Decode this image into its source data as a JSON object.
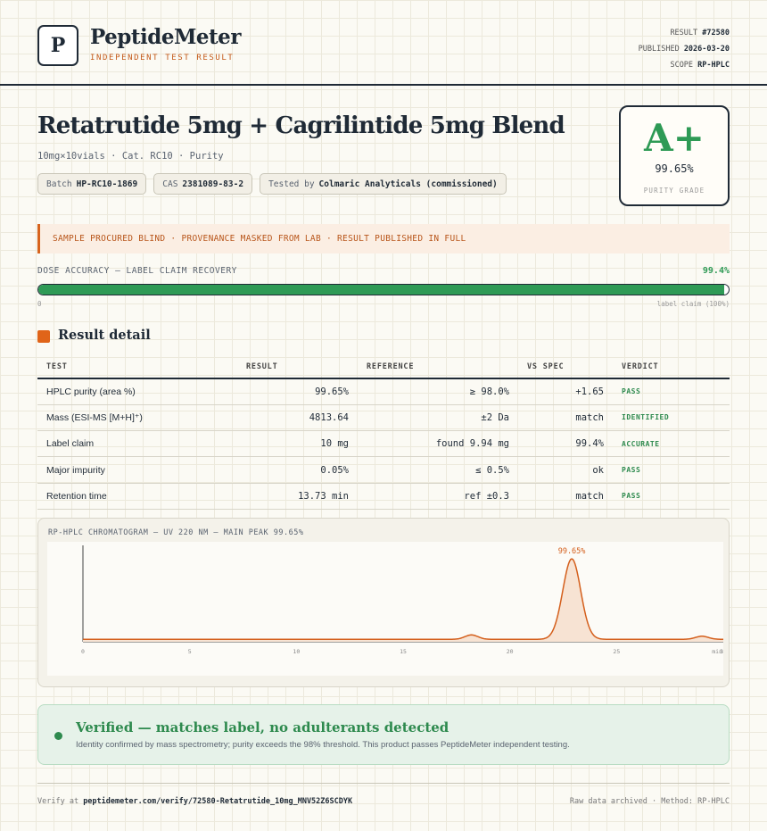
{
  "header": {
    "logo_letter": "P",
    "brand": "PeptideMeter",
    "tagline": "INDEPENDENT TEST RESULT",
    "result_label": "RESULT",
    "result_value": "#72580",
    "published_label": "PUBLISHED",
    "published_value": "2026-03-20",
    "scope_label": "SCOPE",
    "scope_value": "RP-HPLC"
  },
  "product": {
    "title": "Retatrutide 5mg + Cagrilintide 5mg Blend",
    "subtitle": "10mg×10vials · Cat. RC10 · Purity",
    "batch_label": "Batch",
    "batch_value": "HP-RC10-1869",
    "cas_label": "CAS",
    "cas_value": "2381089-83-2",
    "tested_label": "Tested by",
    "tested_value": "Colmaric Analyticals (commissioned)"
  },
  "grade": {
    "letter": "A+",
    "purity": "99.65%",
    "label": "PURITY GRADE",
    "color": "#2e9a55"
  },
  "notice": "SAMPLE PROCURED BLIND · PROVENANCE MASKED FROM LAB · RESULT PUBLISHED IN FULL",
  "dose": {
    "label": "DOSE ACCURACY — LABEL CLAIM RECOVERY",
    "value_text": "99.4%",
    "fraction": 0.994,
    "min_label": "0",
    "max_label": "label claim (100%)"
  },
  "results": {
    "title": "Result detail",
    "columns": [
      "TEST",
      "RESULT",
      "REFERENCE",
      "VS SPEC",
      "VERDICT"
    ],
    "rows": [
      {
        "test": "HPLC purity (area %)",
        "result": "99.65%",
        "reference": "≥ 98.0%",
        "vs_spec": "+1.65",
        "verdict": "PASS"
      },
      {
        "test": "Mass (ESI-MS [M+H]⁺)",
        "result": "4813.64",
        "reference": "±2 Da",
        "vs_spec": "match",
        "verdict": "IDENTIFIED"
      },
      {
        "test": "Label claim",
        "result": "10 mg",
        "reference": "found 9.94 mg",
        "vs_spec": "99.4%",
        "verdict": "ACCURATE"
      },
      {
        "test": "Major impurity",
        "result": "0.05%",
        "reference": "≤ 0.5%",
        "vs_spec": "ok",
        "verdict": "PASS"
      },
      {
        "test": "Retention time",
        "result": "13.73 min",
        "reference": "ref ±0.3",
        "vs_spec": "match",
        "verdict": "PASS"
      }
    ]
  },
  "chart_data": {
    "type": "line",
    "title": "RP-HPLC CHROMATOGRAM — UV 220 NM — MAIN PEAK 99.65%",
    "xlabel": "min",
    "x_ticks": [
      "0",
      "5",
      "10",
      "15",
      "20",
      "25",
      "30"
    ],
    "xlim": [
      0,
      30
    ],
    "baseline": 0.008,
    "peaks": [
      {
        "rt": 18.2,
        "height": 0.05,
        "width": 0.3
      },
      {
        "rt": 22.9,
        "height": 0.92,
        "width": 0.42
      },
      {
        "rt": 29.0,
        "height": 0.035,
        "width": 0.3
      }
    ],
    "main_peak_label": "99.65%",
    "line_color": "#d45f1c",
    "fill_color": "#f7e3d3"
  },
  "verified": {
    "heading": "Verified — matches label, no adulterants detected",
    "text": "Identity confirmed by mass spectrometry; purity exceeds the 98% threshold. This product passes PeptideMeter independent testing."
  },
  "footer": {
    "verify_prefix": "Verify at",
    "verify_url": "peptidemeter.com/verify/72580-Retatrutide_10mg_MNV52Z6SCDYK",
    "right": "Raw data archived · Method: RP-HPLC"
  }
}
